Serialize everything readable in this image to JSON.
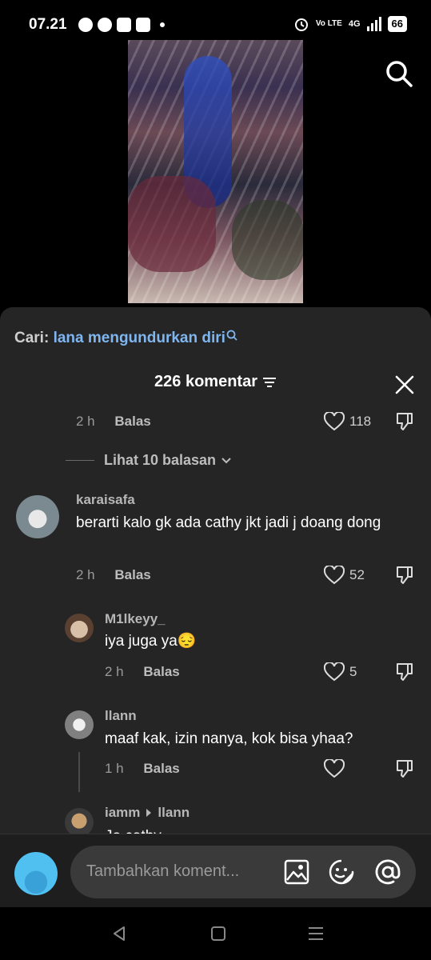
{
  "status_bar": {
    "time": "07.21",
    "volte": "Vo LTE",
    "network": "4G",
    "battery": "66"
  },
  "search": {
    "label": "Cari:",
    "query": "lana mengundurkan diri"
  },
  "comments_header": {
    "title": "226 komentar"
  },
  "first_comment_meta": {
    "time": "2 h",
    "reply": "Balas",
    "likes": "118"
  },
  "view_replies": "Lihat 10 balasan",
  "comments": [
    {
      "username": "karaisafa",
      "text": "berarti kalo gk ada cathy jkt jadi j doang dong",
      "time": "2 h",
      "reply": "Balas",
      "likes": "52"
    },
    {
      "username": "M1lkeyy_",
      "text": "iya juga ya😔",
      "time": "2 h",
      "reply": "Balas",
      "likes": "5"
    },
    {
      "username": "llann",
      "text": "maaf kak, izin nanya, kok bisa yhaa?",
      "time": "1 h",
      "reply": "Balas",
      "likes": ""
    },
    {
      "username": "iamm",
      "reply_to": "llann",
      "text": "Jo cathy"
    }
  ],
  "composer": {
    "placeholder": "Tambahkan koment..."
  },
  "icons": {
    "image": "image-icon",
    "emoji": "emoji-icon",
    "mention": "mention-icon"
  }
}
